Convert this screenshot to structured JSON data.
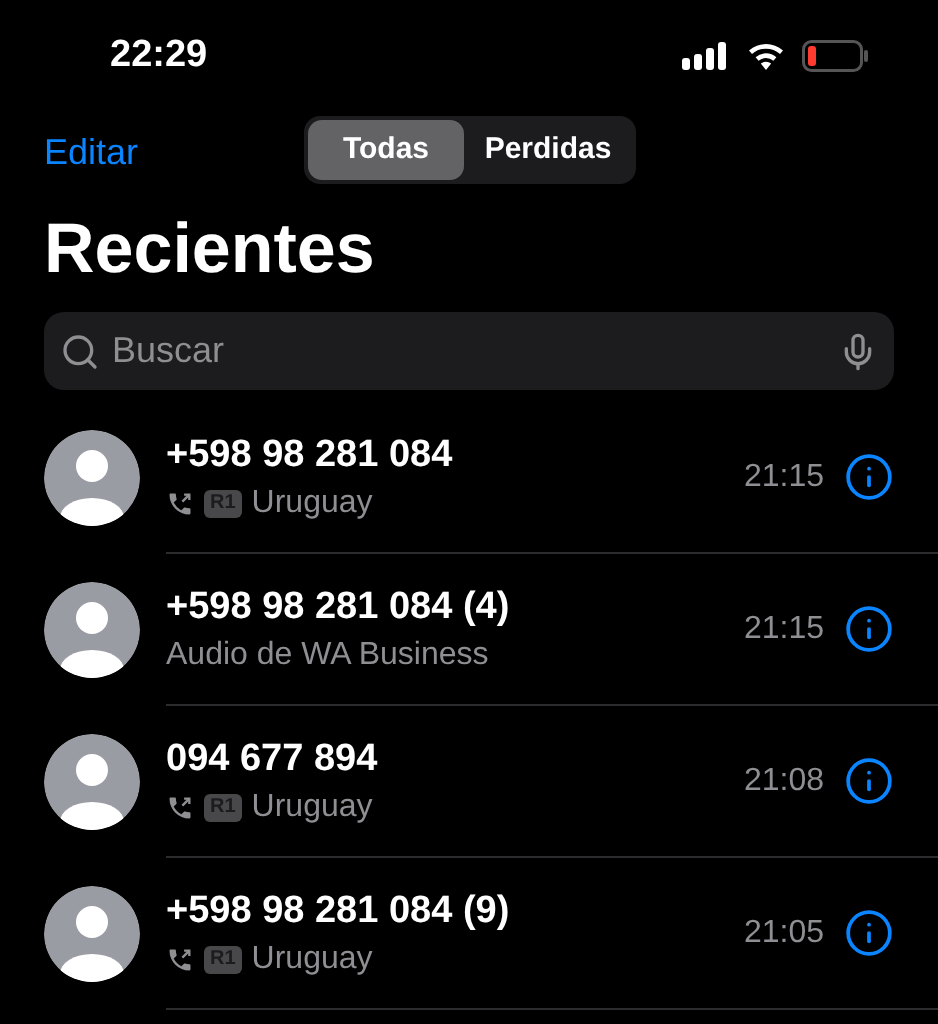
{
  "status_bar": {
    "time": "22:29"
  },
  "nav": {
    "edit": "Editar",
    "segments": [
      {
        "label": "Todas",
        "selected": true
      },
      {
        "label": "Perdidas",
        "selected": false
      }
    ]
  },
  "title": "Recientes",
  "search": {
    "placeholder": "Buscar"
  },
  "calls": [
    {
      "kind": "call",
      "name": "+598 98 281 084",
      "sim": "R1",
      "detail": "Uruguay",
      "time": "21:15"
    },
    {
      "kind": "audio",
      "name": "+598 98 281 084 (4)",
      "detail": "Audio de WA Business",
      "time": "21:15"
    },
    {
      "kind": "call",
      "name": "094 677 894",
      "sim": "R1",
      "detail": "Uruguay",
      "time": "21:08"
    },
    {
      "kind": "call",
      "name": "+598 98 281 084 (9)",
      "sim": "R1",
      "detail": "Uruguay",
      "time": "21:05"
    }
  ]
}
